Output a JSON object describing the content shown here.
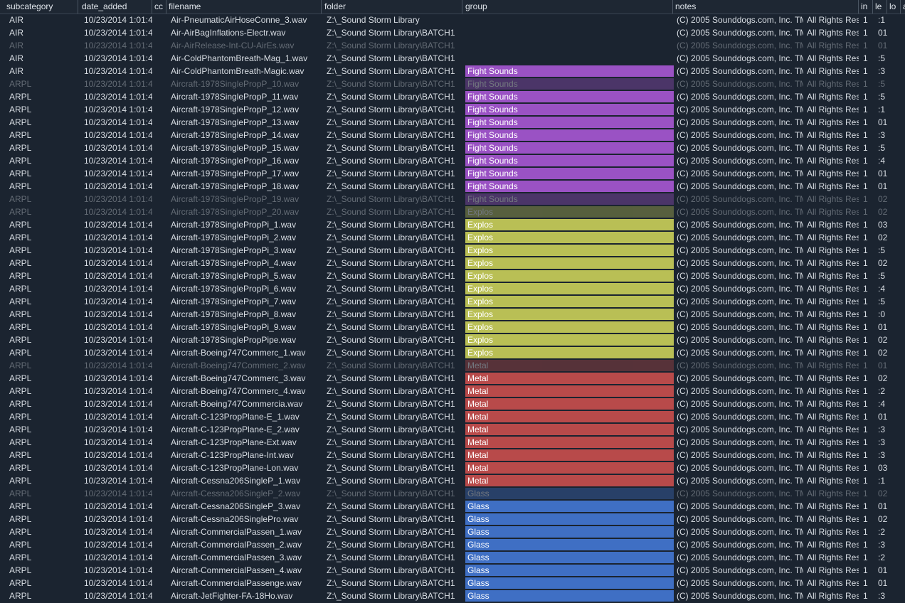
{
  "columns": {
    "subcategory": "subcategory",
    "date_added": "date_added",
    "cc": "cc",
    "filename": "filename",
    "folder": "folder",
    "group": "group",
    "notes": "notes",
    "in": "in",
    "le": "le",
    "lo": "lo",
    "extra": "a"
  },
  "group_colors": {
    "Fight Sounds": "#9a52c4",
    "Explos": "#b9bf55",
    "Metal": "#b84a4a",
    "Glass": "#3f6fc4"
  },
  "rows": [
    {
      "subcategory": "AIR",
      "date_added": "10/23/2014 1:01:4",
      "filename": "Air-PneumaticAirHoseConne_3.wav",
      "folder": "Z:\\_Sound Storm Library",
      "group": "",
      "notes1": "(C) 2005 Sounddogs.com, Inc. TM",
      "notes2": "All Rights Res",
      "in": "1",
      "le": ":1",
      "dim": false
    },
    {
      "subcategory": "AIR",
      "date_added": "10/23/2014 1:01:4",
      "filename": "Air-AirBagInflations-Electr.wav",
      "folder": "Z:\\_Sound Storm Library\\BATCH1",
      "group": "",
      "notes1": "(C) 2005 Sounddogs.com, Inc. TM",
      "notes2": "All Rights Res",
      "in": "1",
      "le": "01:",
      "dim": false
    },
    {
      "subcategory": "AIR",
      "date_added": "10/23/2014 1:01:4",
      "filename": "Air-AirRelease-Int-CU-AirEs.wav",
      "folder": "Z:\\_Sound Storm Library\\BATCH1",
      "group": "",
      "notes1": "(C) 2005 Sounddogs.com, Inc. TM",
      "notes2": "All Rights Res",
      "in": "1",
      "le": "01:",
      "dim": true
    },
    {
      "subcategory": "AIR",
      "date_added": "10/23/2014 1:01:4",
      "filename": "Air-ColdPhantomBreath-Mag_1.wav",
      "folder": "Z:\\_Sound Storm Library\\BATCH1",
      "group": "",
      "notes1": "(C) 2005 Sounddogs.com, Inc. TM",
      "notes2": "All Rights Res",
      "in": "1",
      "le": ":5",
      "dim": false
    },
    {
      "subcategory": "AIR",
      "date_added": "10/23/2014 1:01:4",
      "filename": "Air-ColdPhantomBreath-Magic.wav",
      "folder": "Z:\\_Sound Storm Library\\BATCH1",
      "group": "Fight Sounds",
      "notes1": "(C) 2005 Sounddogs.com, Inc. TM",
      "notes2": "All Rights Res",
      "in": "1",
      "le": ":3",
      "dim": false
    },
    {
      "subcategory": "ARPL",
      "date_added": "10/23/2014 1:01:4",
      "filename": "Aircraft-1978SinglePropP_10.wav",
      "folder": "Z:\\_Sound Storm Library\\BATCH1",
      "group": "Fight Sounds",
      "notes1": "(C) 2005 Sounddogs.com, Inc. TM",
      "notes2": "All Rights Res",
      "in": "1",
      "le": ":5",
      "dim": true
    },
    {
      "subcategory": "ARPL",
      "date_added": "10/23/2014 1:01:4",
      "filename": "Aircraft-1978SinglePropP_11.wav",
      "folder": "Z:\\_Sound Storm Library\\BATCH1",
      "group": "Fight Sounds",
      "notes1": "(C) 2005 Sounddogs.com, Inc. TM",
      "notes2": "All Rights Res",
      "in": "1",
      "le": ":5",
      "dim": false
    },
    {
      "subcategory": "ARPL",
      "date_added": "10/23/2014 1:01:4",
      "filename": "Aircraft-1978SinglePropP_12.wav",
      "folder": "Z:\\_Sound Storm Library\\BATCH1",
      "group": "Fight Sounds",
      "notes1": "(C) 2005 Sounddogs.com, Inc. TM",
      "notes2": "All Rights Res",
      "in": "1",
      "le": ":1",
      "dim": false
    },
    {
      "subcategory": "ARPL",
      "date_added": "10/23/2014 1:01:4",
      "filename": "Aircraft-1978SinglePropP_13.wav",
      "folder": "Z:\\_Sound Storm Library\\BATCH1",
      "group": "Fight Sounds",
      "notes1": "(C) 2005 Sounddogs.com, Inc. TM",
      "notes2": "All Rights Res",
      "in": "1",
      "le": "01:",
      "dim": false
    },
    {
      "subcategory": "ARPL",
      "date_added": "10/23/2014 1:01:4",
      "filename": "Aircraft-1978SinglePropP_14.wav",
      "folder": "Z:\\_Sound Storm Library\\BATCH1",
      "group": "Fight Sounds",
      "notes1": "(C) 2005 Sounddogs.com, Inc. TM",
      "notes2": "All Rights Res",
      "in": "1",
      "le": ":3",
      "dim": false
    },
    {
      "subcategory": "ARPL",
      "date_added": "10/23/2014 1:01:4",
      "filename": "Aircraft-1978SinglePropP_15.wav",
      "folder": "Z:\\_Sound Storm Library\\BATCH1",
      "group": "Fight Sounds",
      "notes1": "(C) 2005 Sounddogs.com, Inc. TM",
      "notes2": "All Rights Res",
      "in": "1",
      "le": ":5",
      "dim": false
    },
    {
      "subcategory": "ARPL",
      "date_added": "10/23/2014 1:01:4",
      "filename": "Aircraft-1978SinglePropP_16.wav",
      "folder": "Z:\\_Sound Storm Library\\BATCH1",
      "group": "Fight Sounds",
      "notes1": "(C) 2005 Sounddogs.com, Inc. TM",
      "notes2": "All Rights Res",
      "in": "1",
      "le": ":4",
      "dim": false
    },
    {
      "subcategory": "ARPL",
      "date_added": "10/23/2014 1:01:4",
      "filename": "Aircraft-1978SinglePropP_17.wav",
      "folder": "Z:\\_Sound Storm Library\\BATCH1",
      "group": "Fight Sounds",
      "notes1": "(C) 2005 Sounddogs.com, Inc. TM",
      "notes2": "All Rights Res",
      "in": "1",
      "le": "01:",
      "dim": false
    },
    {
      "subcategory": "ARPL",
      "date_added": "10/23/2014 1:01:4",
      "filename": "Aircraft-1978SinglePropP_18.wav",
      "folder": "Z:\\_Sound Storm Library\\BATCH1",
      "group": "Fight Sounds",
      "notes1": "(C) 2005 Sounddogs.com, Inc. TM",
      "notes2": "All Rights Res",
      "in": "1",
      "le": "01:",
      "dim": false
    },
    {
      "subcategory": "ARPL",
      "date_added": "10/23/2014 1:01:4",
      "filename": "Aircraft-1978SinglePropP_19.wav",
      "folder": "Z:\\_Sound Storm Library\\BATCH1",
      "group": "Fight Sounds",
      "notes1": "(C) 2005 Sounddogs.com, Inc. TM",
      "notes2": "All Rights Res",
      "in": "1",
      "le": "02:",
      "dim": true
    },
    {
      "subcategory": "ARPL",
      "date_added": "10/23/2014 1:01:4",
      "filename": "Aircraft-1978SinglePropP_20.wav",
      "folder": "Z:\\_Sound Storm Library\\BATCH1",
      "group": "Explos",
      "notes1": "(C) 2005 Sounddogs.com, Inc. TM",
      "notes2": "All Rights Res",
      "in": "1",
      "le": "02:",
      "dim": true
    },
    {
      "subcategory": "ARPL",
      "date_added": "10/23/2014 1:01:4",
      "filename": "Aircraft-1978SinglePropPi_1.wav",
      "folder": "Z:\\_Sound Storm Library\\BATCH1",
      "group": "Explos",
      "notes1": "(C) 2005 Sounddogs.com, Inc. TM",
      "notes2": "All Rights Res",
      "in": "1",
      "le": "03:",
      "dim": false
    },
    {
      "subcategory": "ARPL",
      "date_added": "10/23/2014 1:01:4",
      "filename": "Aircraft-1978SinglePropPi_2.wav",
      "folder": "Z:\\_Sound Storm Library\\BATCH1",
      "group": "Explos",
      "notes1": "(C) 2005 Sounddogs.com, Inc. TM",
      "notes2": "All Rights Res",
      "in": "1",
      "le": "02:",
      "dim": false
    },
    {
      "subcategory": "ARPL",
      "date_added": "10/23/2014 1:01:4",
      "filename": "Aircraft-1978SinglePropPi_3.wav",
      "folder": "Z:\\_Sound Storm Library\\BATCH1",
      "group": "Explos",
      "notes1": "(C) 2005 Sounddogs.com, Inc. TM",
      "notes2": "All Rights Res",
      "in": "1",
      "le": ":5",
      "dim": false
    },
    {
      "subcategory": "ARPL",
      "date_added": "10/23/2014 1:01:4",
      "filename": "Aircraft-1978SinglePropPi_4.wav",
      "folder": "Z:\\_Sound Storm Library\\BATCH1",
      "group": "Explos",
      "notes1": "(C) 2005 Sounddogs.com, Inc. TM",
      "notes2": "All Rights Res",
      "in": "1",
      "le": "02:",
      "dim": false
    },
    {
      "subcategory": "ARPL",
      "date_added": "10/23/2014 1:01:4",
      "filename": "Aircraft-1978SinglePropPi_5.wav",
      "folder": "Z:\\_Sound Storm Library\\BATCH1",
      "group": "Explos",
      "notes1": "(C) 2005 Sounddogs.com, Inc. TM",
      "notes2": "All Rights Res",
      "in": "1",
      "le": ":5",
      "dim": false
    },
    {
      "subcategory": "ARPL",
      "date_added": "10/23/2014 1:01:4",
      "filename": "Aircraft-1978SinglePropPi_6.wav",
      "folder": "Z:\\_Sound Storm Library\\BATCH1",
      "group": "Explos",
      "notes1": "(C) 2005 Sounddogs.com, Inc. TM",
      "notes2": "All Rights Res",
      "in": "1",
      "le": ":4",
      "dim": false
    },
    {
      "subcategory": "ARPL",
      "date_added": "10/23/2014 1:01:4",
      "filename": "Aircraft-1978SinglePropPi_7.wav",
      "folder": "Z:\\_Sound Storm Library\\BATCH1",
      "group": "Explos",
      "notes1": "(C) 2005 Sounddogs.com, Inc. TM",
      "notes2": "All Rights Res",
      "in": "1",
      "le": ":5",
      "dim": false
    },
    {
      "subcategory": "ARPL",
      "date_added": "10/23/2014 1:01:4",
      "filename": "Aircraft-1978SinglePropPi_8.wav",
      "folder": "Z:\\_Sound Storm Library\\BATCH1",
      "group": "Explos",
      "notes1": "(C) 2005 Sounddogs.com, Inc. TM",
      "notes2": "All Rights Res",
      "in": "1",
      "le": ":0",
      "dim": false
    },
    {
      "subcategory": "ARPL",
      "date_added": "10/23/2014 1:01:4",
      "filename": "Aircraft-1978SinglePropPi_9.wav",
      "folder": "Z:\\_Sound Storm Library\\BATCH1",
      "group": "Explos",
      "notes1": "(C) 2005 Sounddogs.com, Inc. TM",
      "notes2": "All Rights Res",
      "in": "1",
      "le": "01:",
      "dim": false
    },
    {
      "subcategory": "ARPL",
      "date_added": "10/23/2014 1:01:4",
      "filename": "Aircraft-1978SinglePropPipe.wav",
      "folder": "Z:\\_Sound Storm Library\\BATCH1",
      "group": "Explos",
      "notes1": "(C) 2005 Sounddogs.com, Inc. TM",
      "notes2": "All Rights Res",
      "in": "1",
      "le": "02:",
      "dim": false
    },
    {
      "subcategory": "ARPL",
      "date_added": "10/23/2014 1:01:4",
      "filename": "Aircraft-Boeing747Commerc_1.wav",
      "folder": "Z:\\_Sound Storm Library\\BATCH1",
      "group": "Explos",
      "notes1": "(C) 2005 Sounddogs.com, Inc. TM",
      "notes2": "All Rights Res",
      "in": "1",
      "le": "02:",
      "dim": false
    },
    {
      "subcategory": "ARPL",
      "date_added": "10/23/2014 1:01:4",
      "filename": "Aircraft-Boeing747Commerc_2.wav",
      "folder": "Z:\\_Sound Storm Library\\BATCH1",
      "group": "Metal",
      "notes1": "(C) 2005 Sounddogs.com, Inc. TM",
      "notes2": "All Rights Res",
      "in": "1",
      "le": "01:",
      "dim": true
    },
    {
      "subcategory": "ARPL",
      "date_added": "10/23/2014 1:01:4",
      "filename": "Aircraft-Boeing747Commerc_3.wav",
      "folder": "Z:\\_Sound Storm Library\\BATCH1",
      "group": "Metal",
      "notes1": "(C) 2005 Sounddogs.com, Inc. TM",
      "notes2": "All Rights Res",
      "in": "1",
      "le": "02:",
      "dim": false
    },
    {
      "subcategory": "ARPL",
      "date_added": "10/23/2014 1:01:4",
      "filename": "Aircraft-Boeing747Commerc_4.wav",
      "folder": "Z:\\_Sound Storm Library\\BATCH1",
      "group": "Metal",
      "notes1": "(C) 2005 Sounddogs.com, Inc. TM",
      "notes2": "All Rights Res",
      "in": "1",
      "le": ":2",
      "dim": false
    },
    {
      "subcategory": "ARPL",
      "date_added": "10/23/2014 1:01:4",
      "filename": "Aircraft-Boeing747Commercia.wav",
      "folder": "Z:\\_Sound Storm Library\\BATCH1",
      "group": "Metal",
      "notes1": "(C) 2005 Sounddogs.com, Inc. TM",
      "notes2": "All Rights Res",
      "in": "1",
      "le": ":4",
      "dim": false
    },
    {
      "subcategory": "ARPL",
      "date_added": "10/23/2014 1:01:4",
      "filename": "Aircraft-C-123PropPlane-E_1.wav",
      "folder": "Z:\\_Sound Storm Library\\BATCH1",
      "group": "Metal",
      "notes1": "(C) 2005 Sounddogs.com, Inc. TM",
      "notes2": "All Rights Res",
      "in": "1",
      "le": "01:",
      "dim": false
    },
    {
      "subcategory": "ARPL",
      "date_added": "10/23/2014 1:01:4",
      "filename": "Aircraft-C-123PropPlane-E_2.wav",
      "folder": "Z:\\_Sound Storm Library\\BATCH1",
      "group": "Metal",
      "notes1": "(C) 2005 Sounddogs.com, Inc. TM",
      "notes2": "All Rights Res",
      "in": "1",
      "le": ":3",
      "dim": false
    },
    {
      "subcategory": "ARPL",
      "date_added": "10/23/2014 1:01:4",
      "filename": "Aircraft-C-123PropPlane-Ext.wav",
      "folder": "Z:\\_Sound Storm Library\\BATCH1",
      "group": "Metal",
      "notes1": "(C) 2005 Sounddogs.com, Inc. TM",
      "notes2": "All Rights Res",
      "in": "1",
      "le": ":3",
      "dim": false
    },
    {
      "subcategory": "ARPL",
      "date_added": "10/23/2014 1:01:4",
      "filename": "Aircraft-C-123PropPlane-Int.wav",
      "folder": "Z:\\_Sound Storm Library\\BATCH1",
      "group": "Metal",
      "notes1": "(C) 2005 Sounddogs.com, Inc. TM",
      "notes2": "All Rights Res",
      "in": "1",
      "le": ":3",
      "dim": false
    },
    {
      "subcategory": "ARPL",
      "date_added": "10/23/2014 1:01:4",
      "filename": "Aircraft-C-123PropPlane-Lon.wav",
      "folder": "Z:\\_Sound Storm Library\\BATCH1",
      "group": "Metal",
      "notes1": "(C) 2005 Sounddogs.com, Inc. TM",
      "notes2": "All Rights Res",
      "in": "1",
      "le": "03:",
      "dim": false
    },
    {
      "subcategory": "ARPL",
      "date_added": "10/23/2014 1:01:4",
      "filename": "Aircraft-Cessna206SingleP_1.wav",
      "folder": "Z:\\_Sound Storm Library\\BATCH1",
      "group": "Metal",
      "notes1": "(C) 2005 Sounddogs.com, Inc. TM",
      "notes2": "All Rights Res",
      "in": "1",
      "le": ":1",
      "dim": false
    },
    {
      "subcategory": "ARPL",
      "date_added": "10/23/2014 1:01:4",
      "filename": "Aircraft-Cessna206SingleP_2.wav",
      "folder": "Z:\\_Sound Storm Library\\BATCH1",
      "group": "Glass",
      "notes1": "(C) 2005 Sounddogs.com, Inc. TM",
      "notes2": "All Rights Res",
      "in": "1",
      "le": "02:",
      "dim": true
    },
    {
      "subcategory": "ARPL",
      "date_added": "10/23/2014 1:01:4",
      "filename": "Aircraft-Cessna206SingleP_3.wav",
      "folder": "Z:\\_Sound Storm Library\\BATCH1",
      "group": "Glass",
      "notes1": "(C) 2005 Sounddogs.com, Inc. TM",
      "notes2": "All Rights Res",
      "in": "1",
      "le": "01:",
      "dim": false
    },
    {
      "subcategory": "ARPL",
      "date_added": "10/23/2014 1:01:4",
      "filename": "Aircraft-Cessna206SinglePro.wav",
      "folder": "Z:\\_Sound Storm Library\\BATCH1",
      "group": "Glass",
      "notes1": "(C) 2005 Sounddogs.com, Inc. TM",
      "notes2": "All Rights Res",
      "in": "1",
      "le": "02:",
      "dim": false
    },
    {
      "subcategory": "ARPL",
      "date_added": "10/23/2014 1:01:4",
      "filename": "Aircraft-CommercialPassen_1.wav",
      "folder": "Z:\\_Sound Storm Library\\BATCH1",
      "group": "Glass",
      "notes1": "(C) 2005 Sounddogs.com, Inc. TM",
      "notes2": "All Rights Res",
      "in": "1",
      "le": ":2",
      "dim": false
    },
    {
      "subcategory": "ARPL",
      "date_added": "10/23/2014 1:01:4",
      "filename": "Aircraft-CommercialPassen_2.wav",
      "folder": "Z:\\_Sound Storm Library\\BATCH1",
      "group": "Glass",
      "notes1": "(C) 2005 Sounddogs.com, Inc. TM",
      "notes2": "All Rights Res",
      "in": "1",
      "le": ":3",
      "dim": false
    },
    {
      "subcategory": "ARPL",
      "date_added": "10/23/2014 1:01:4",
      "filename": "Aircraft-CommercialPassen_3.wav",
      "folder": "Z:\\_Sound Storm Library\\BATCH1",
      "group": "Glass",
      "notes1": "(C) 2005 Sounddogs.com, Inc. TM",
      "notes2": "All Rights Res",
      "in": "1",
      "le": ":2",
      "dim": false
    },
    {
      "subcategory": "ARPL",
      "date_added": "10/23/2014 1:01:4",
      "filename": "Aircraft-CommercialPassen_4.wav",
      "folder": "Z:\\_Sound Storm Library\\BATCH1",
      "group": "Glass",
      "notes1": "(C) 2005 Sounddogs.com, Inc. TM",
      "notes2": "All Rights Res",
      "in": "1",
      "le": "01:",
      "dim": false
    },
    {
      "subcategory": "ARPL",
      "date_added": "10/23/2014 1:01:4",
      "filename": "Aircraft-CommercialPassenge.wav",
      "folder": "Z:\\_Sound Storm Library\\BATCH1",
      "group": "Glass",
      "notes1": "(C) 2005 Sounddogs.com, Inc. TM",
      "notes2": "All Rights Res",
      "in": "1",
      "le": "01:",
      "dim": false
    },
    {
      "subcategory": "ARPL",
      "date_added": "10/23/2014 1:01:4",
      "filename": "Aircraft-JetFighter-FA-18Ho.wav",
      "folder": "Z:\\_Sound Storm Library\\BATCH1",
      "group": "Glass",
      "notes1": "(C) 2005 Sounddogs.com, Inc. TM",
      "notes2": "All Rights Res",
      "in": "1",
      "le": ":3",
      "dim": false
    }
  ]
}
